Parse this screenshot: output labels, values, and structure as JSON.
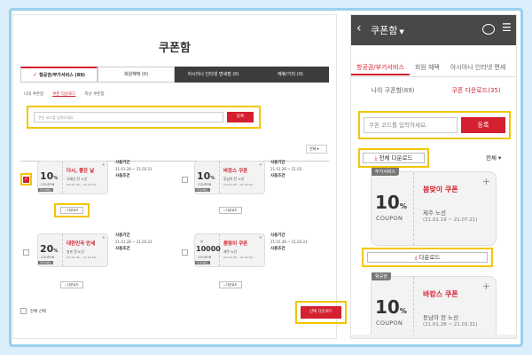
{
  "desktop": {
    "title": "쿠폰함",
    "tabs": [
      {
        "label": "항공권/부가서비스 (89)",
        "active": true
      },
      {
        "label": "회원혜택 (0)"
      },
      {
        "label": "아시아나 인터넷 면세점 (0)"
      },
      {
        "label": "제휴/기타 (0)"
      }
    ],
    "subtabs": [
      "나의 쿠폰함",
      "쿠폰 다운로드",
      "지난 쿠폰함"
    ],
    "search": {
      "placeholder": "쿠폰 코드를 입력하세요.",
      "button": "등록"
    },
    "filter": "전체",
    "coupons": [
      {
        "value": "10",
        "unit": "%",
        "coupon_label": "COUPON",
        "badge": "부가서비스",
        "name": "다시, 좋은 날",
        "route": "국제선 전 노선",
        "dates": "(21.01.28 ~ 21.03.31)",
        "period_label": "사용기간",
        "period": "21.01.28 ~ 21.03.31",
        "cond_label": "사용조건",
        "download": "다운로드",
        "checked": true
      },
      {
        "value": "10",
        "unit": "%",
        "coupon_label": "COUPON",
        "badge": "부가서비스",
        "name": "바캉스 쿠폰",
        "route": "동남아 전 노선",
        "dates": "(21.01.28 ~ 21.03.31)",
        "period_label": "사용기간",
        "period": "21.01.28 ~ 21.03.",
        "cond_label": "사용조건",
        "download": "다운로드",
        "checked": false
      },
      {
        "value": "20",
        "unit": "%",
        "coupon_label": "COUPON",
        "badge": "부가서비스",
        "name": "대한민국 만세",
        "route": "일본 전 노선",
        "dates": "(21.01.04 ~ 21.03.31)",
        "period_label": "사용기간",
        "period": "21.01.28 ~ 21.03.31",
        "cond_label": "사용조건",
        "download": "다운로드",
        "checked": false
      },
      {
        "value": "10000",
        "won_label": "원",
        "coupon_label": "COUPON",
        "badge": "부가서비스",
        "name": "봄맞이 쿠폰",
        "route": "제주 노선",
        "dates": "(21.01.28 ~ 21.03.31)",
        "period_label": "사용기간",
        "period": "21.01.28 ~ 21.03.31",
        "cond_label": "사용조건",
        "download": "다운로드",
        "checked": false
      }
    ],
    "select_all": "전체 선택",
    "select_download": "선택 다운로드"
  },
  "mobile": {
    "title": "쿠폰함",
    "tabs": [
      "항공권/부가서비스",
      "회원 혜택",
      "아시아나 인터넷 면세"
    ],
    "subtabs": [
      "나의 쿠폰함(89)",
      "쿠폰 다운로드(35)"
    ],
    "search": {
      "placeholder": "쿠폰 코드를 입력하세요.",
      "button": "등록"
    },
    "download_all": "전체 다운로드",
    "filter": "전체",
    "coupons": [
      {
        "badge": "부가서비스",
        "value": "10",
        "unit": "%",
        "coupon_label": "COUPON",
        "name": "봄맞이 쿠폰",
        "route": "제주 노선",
        "dates": "(21.01.19 ~ 21.07.21)"
      },
      {
        "badge": "항공권",
        "value": "10",
        "unit": "%",
        "coupon_label": "COUPON",
        "name": "바캉스 쿠폰",
        "route": "동남아 전 노선",
        "dates": "(21.01.28 ~ 21.03.31)"
      }
    ],
    "download": "다운로드"
  },
  "colors": {
    "accent": "#d4202f",
    "highlight": "#f3c500",
    "header": "#484848"
  }
}
